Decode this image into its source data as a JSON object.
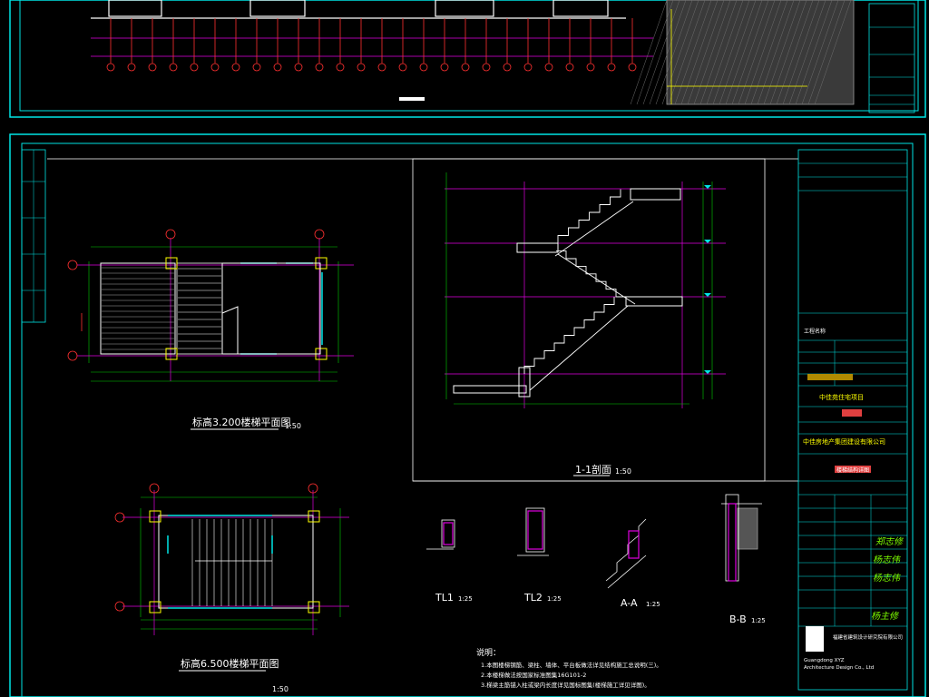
{
  "colors": {
    "frame": "#00e5e5",
    "grid_magenta": "#e000e0",
    "dim_green": "#00d000",
    "wall_white": "#ffffff",
    "yellow": "#ffff00",
    "red": "#ff3030",
    "hatch_gray": "#8a8a8a",
    "background": "#000000"
  },
  "top_sheet": {
    "scale_marker": "■"
  },
  "plan_upper": {
    "title": "标高3.200楼梯平面图",
    "scale": "1:50"
  },
  "plan_lower": {
    "title": "标高6.500楼梯平面图",
    "scale": "1:50"
  },
  "section": {
    "title": "1-1剖面",
    "scale": "1:50"
  },
  "details": [
    {
      "title": "TL1",
      "scale": "1:25"
    },
    {
      "title": "TL2",
      "scale": "1:25"
    },
    {
      "title": "A-A",
      "scale": "1:25"
    },
    {
      "title": "B-B",
      "scale": "1:25"
    }
  ],
  "notes": {
    "heading": "说明：",
    "lines": [
      "1.本图楼梯钢筋、梁柱、墙体、平台板做法详见结构施工总说明(三)。",
      "2.本楼梯做法按国家标准图集16G101-2",
      "3.梯梁主筋锚入柱或梁内长度详见国标图集(楼梯施工详见详图)。"
    ]
  },
  "title_block": {
    "project_label": "工程名称",
    "project_name": "中佳苑住宅项目",
    "client_name": "中佳房地产集团建设有限公司",
    "drawing_name": "楼梯结构详图",
    "company_cn": "福建省建筑设计研究院有限公司",
    "company_en_1": "Guangdong XYZ",
    "company_en_2": "Architecture Design Co., Ltd",
    "signatures": [
      "郑志修",
      "杨志伟",
      "杨志伟",
      "杨主修"
    ]
  }
}
